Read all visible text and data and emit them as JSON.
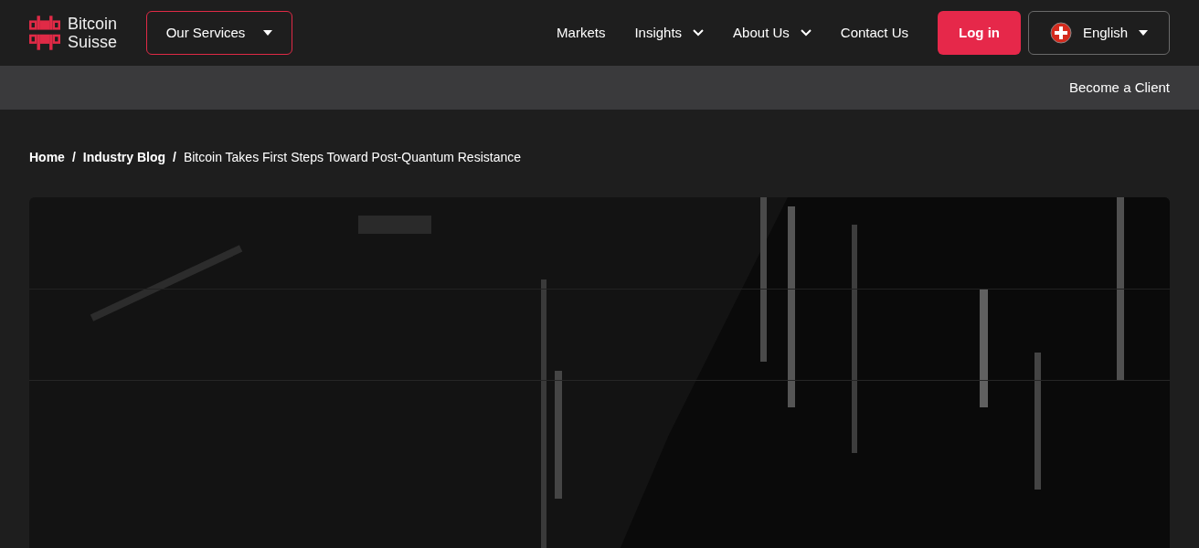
{
  "logo": {
    "line_1": "Bitcoin",
    "line_2": "Suisse"
  },
  "services_button": {
    "label": "Our Services"
  },
  "nav": [
    {
      "label": "Markets",
      "kind": "link"
    },
    {
      "label": "Insights",
      "kind": "dropdown"
    },
    {
      "label": "About Us",
      "kind": "dropdown"
    },
    {
      "label": "Contact Us",
      "kind": "link"
    }
  ],
  "login_button": {
    "label": "Log in"
  },
  "language": {
    "label": "English"
  },
  "sub_bar": {
    "link": "Become a Client"
  },
  "breadcrumb": [
    {
      "label": "Home",
      "kind": "link"
    },
    {
      "label": "Industry Blog",
      "kind": "link"
    },
    {
      "label": "Bitcoin Takes First Steps Toward Post-Quantum Resistance",
      "kind": "current"
    }
  ],
  "breadcrumb_separator": "/"
}
